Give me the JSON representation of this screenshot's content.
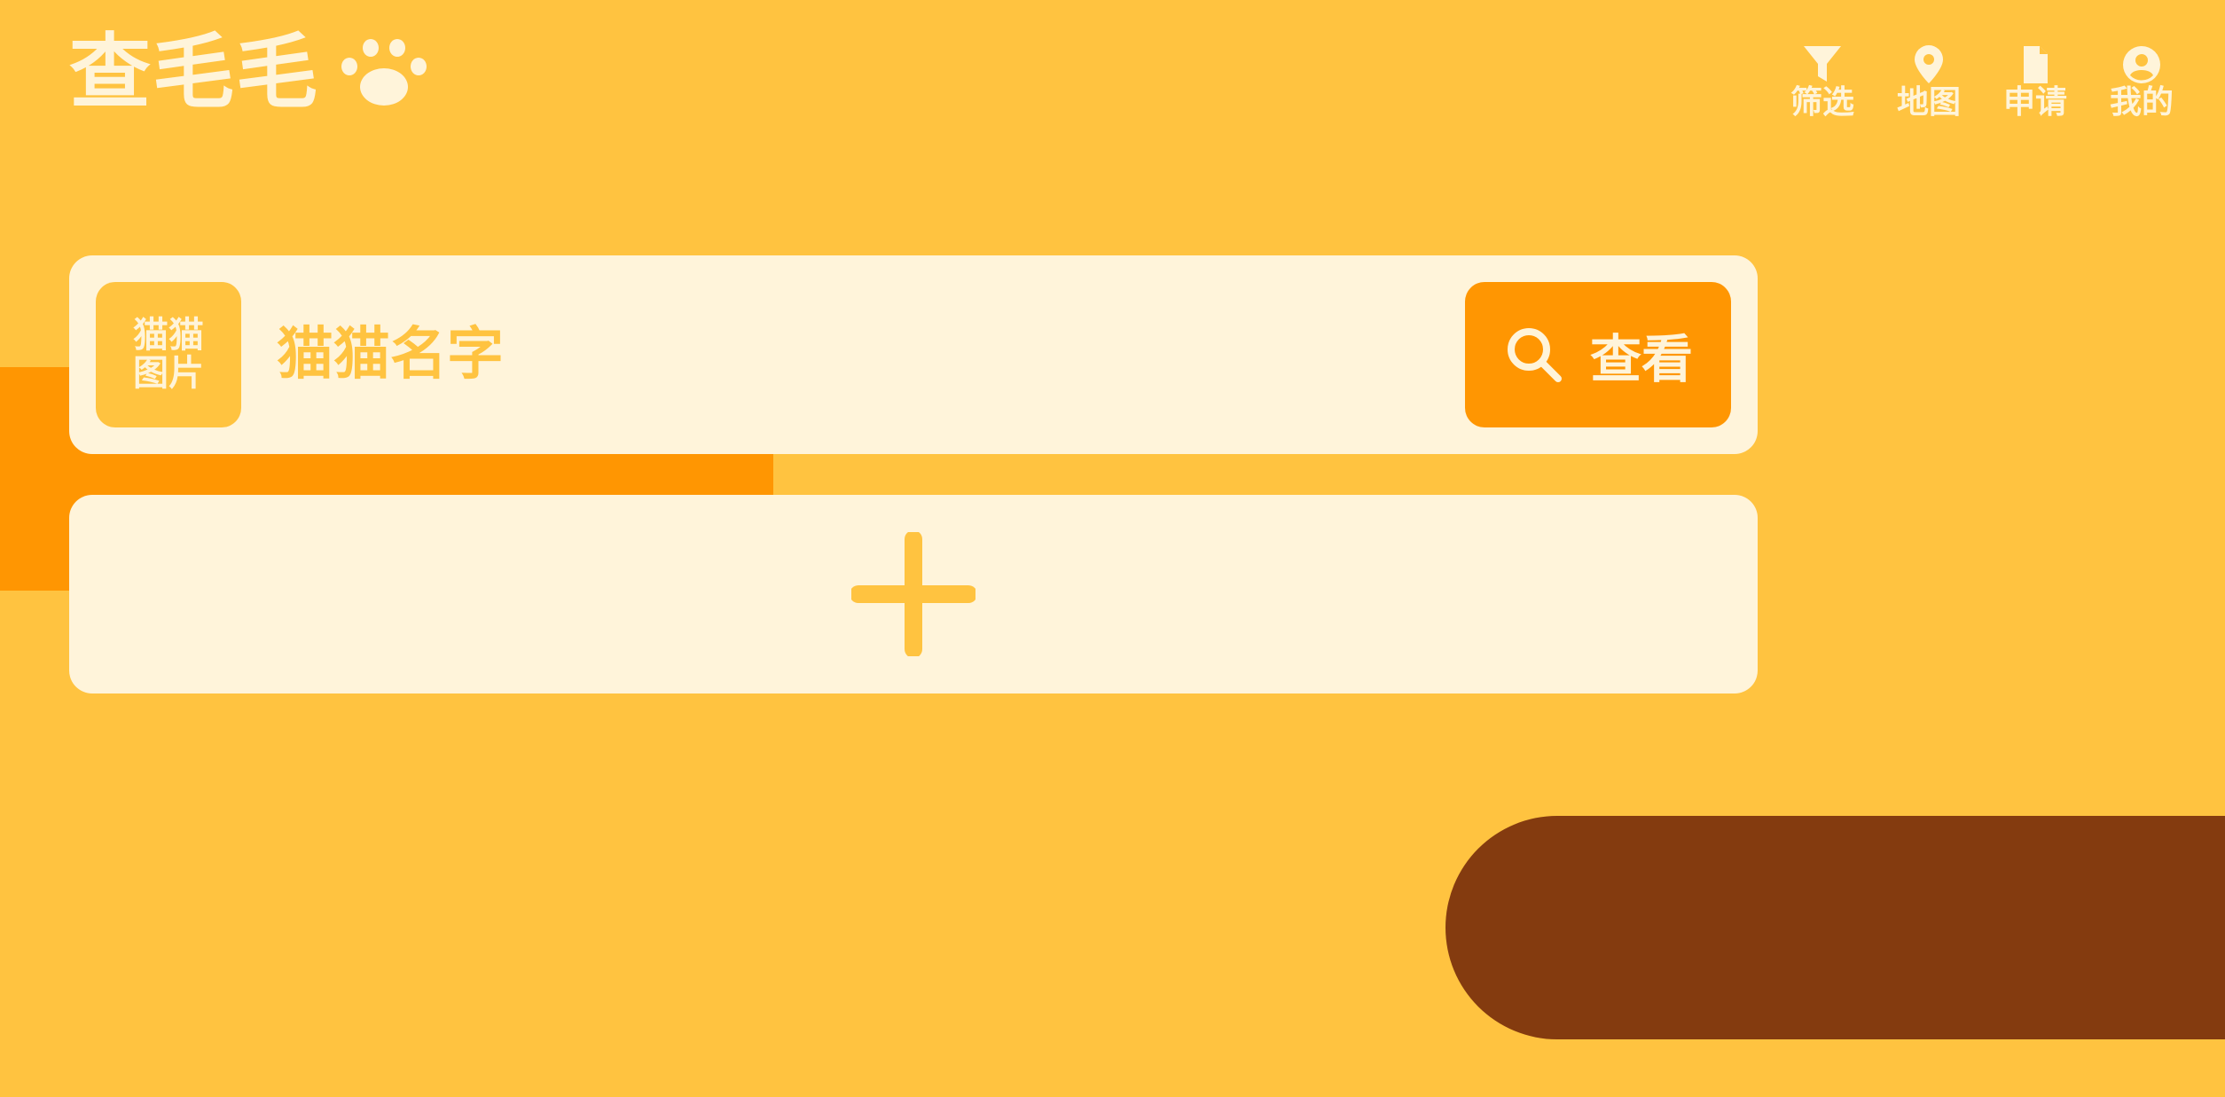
{
  "app": {
    "title": "查毛毛",
    "logo_icon": "paw-icon"
  },
  "nav": {
    "items": [
      {
        "label": "筛选",
        "icon": "filter-icon"
      },
      {
        "label": "地图",
        "icon": "map-pin-icon"
      },
      {
        "label": "申请",
        "icon": "document-icon"
      },
      {
        "label": "我的",
        "icon": "user-icon"
      }
    ]
  },
  "cat_card": {
    "photo_label": "猫猫图片",
    "name_placeholder": "猫猫名字",
    "name_value": "",
    "view_button_label": "查看",
    "view_button_icon": "search-icon"
  },
  "add_card": {
    "icon": "plus-icon"
  },
  "colors": {
    "background": "#FFC340",
    "card": "#FFF4DA",
    "accent_orange": "#FF9602",
    "brown": "#843B0F",
    "text_light": "#FFF4DA"
  }
}
